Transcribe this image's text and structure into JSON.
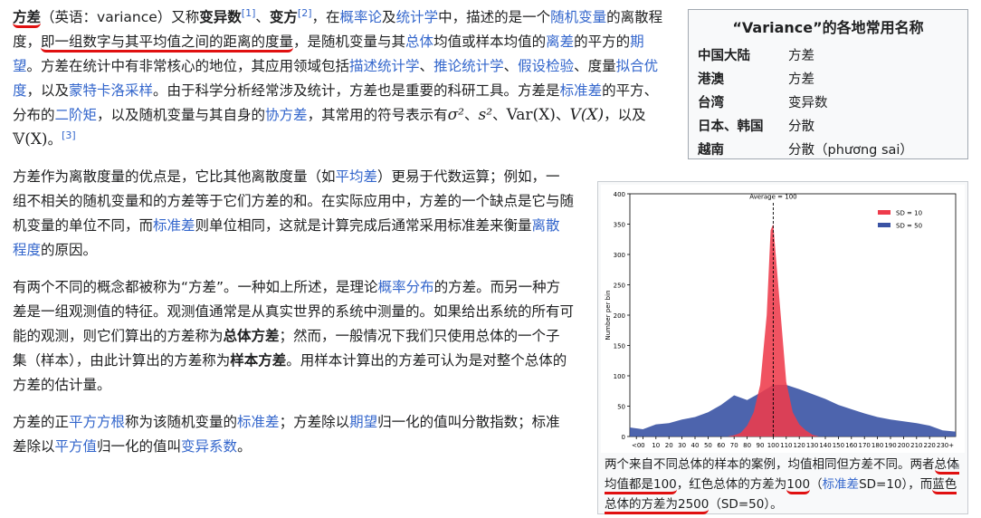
{
  "para1": {
    "term": "方差",
    "paren_open": "（英语：",
    "en": "variance",
    "paren_close": "）又称",
    "alt1": "变异数",
    "ref1": "[1]",
    "sep1": "、",
    "alt2": "变方",
    "ref2": "[2]",
    "t1": "，在",
    "link_prob": "概率论",
    "t2": "及",
    "link_stat": "统计学",
    "t3": "中，描述的是一个",
    "link_rv": "随机变量",
    "t4": "的离散程度，",
    "def": "即一组数字与其平均值之间的距离的度量",
    "t5": "，是随机变量与其",
    "link_pop": "总体",
    "t6": "均值或样本均值的",
    "link_dev": "离差",
    "t7": "的平方的",
    "link_exp": "期望",
    "t8": "。方差在统计中有非常核心的地位，其应用领域包括",
    "link_desc": "描述统计学",
    "t9": "、",
    "link_inf": "推论统计学",
    "t10": "、",
    "link_hyp": "假设检验",
    "t11": "、度量",
    "link_fit": "拟合优度",
    "t12": "，以及",
    "link_mc": "蒙特卡洛采样",
    "t13": "。由于科学分析经常涉及统计，方差也是重要的科研工具。方差是",
    "link_sd": "标准差",
    "t14": "的平方、分布的",
    "link_moment": "二阶矩",
    "t15": "，以及随机变量与其自身的",
    "link_cov": "协方差",
    "t16": "，其常用的符号表示有",
    "sym1": "σ²",
    "t17": "、",
    "sym2": "s²",
    "t18": "、",
    "sym3": "Var(X)",
    "t19": "、",
    "sym4": "V(X)",
    "t20": "，以及",
    "sym5": "𝕍(X)",
    "t21": "。",
    "ref3": "[3]"
  },
  "para2": {
    "t1": "方差作为离散度量的优点是，它比其他离散度量（如",
    "link_md": "平均差",
    "t2": "）更易于代数运算；例如，一组不相关的随机变量和的方差等于它们方差的和。在实际应用中，方差的一个缺点是它与随机变量的单位不同，而",
    "link_sd": "标准差",
    "t3": "则单位相同，这就是计算完成后通常采用标准差来衡量",
    "link_disp": "离散程度",
    "t4": "的原因。"
  },
  "para3": {
    "t1": "有两个不同的概念都被称为“方差”。一种如上所述，是理论",
    "link_pd": "概率分布",
    "t2": "的方差。而另一种方差是一组观测值的特征。观测值通常是从真实世界的系统中测量的。如果给出系统的所有可能的观测，则它们算出的方差称为",
    "b1": "总体方差",
    "t3": "；然而，一般情况下我们只使用总体的一个子集（样本），由此计算出的方差称为",
    "b2": "样本方差",
    "t4": "。用样本计算出的方差可认为是对整个总体的方差的估计量。"
  },
  "para4": {
    "t1": "方差的正",
    "link_sqrt": "平方方根",
    "t2": "称为该随机变量的",
    "link_sd": "标准差",
    "t3": "；方差除以",
    "link_exp": "期望",
    "t4": "归一化的值叫分散指数；标准差除以",
    "link_mean": "平方值",
    "t5": "归一化的值叫",
    "link_cv": "变异系数",
    "t6": "。"
  },
  "infobox": {
    "title": "“Variance”的各地常用名称",
    "rows": [
      {
        "region": "中国大陆",
        "name": "方差"
      },
      {
        "region": "港澳",
        "name": "方差"
      },
      {
        "region": "台湾",
        "name": "变异数"
      },
      {
        "region": "日本、韩国",
        "name": "分散"
      },
      {
        "region": "越南",
        "name": "分散（phương sai）"
      }
    ]
  },
  "figure": {
    "enlarge_icon": "enlarge-icon",
    "caption": {
      "t1": "两个来自不同总体的样本的案例，均值相同但方差不同。两者",
      "u1": "总体均值都是100",
      "t2": "，红色总体的方差为",
      "u2": "100",
      "t3": "（",
      "link_sd": "标准差",
      "t4": "SD=10），而",
      "u3": "蓝色总体的方差为2500",
      "t5": "（SD=50）。"
    }
  },
  "chart_data": {
    "type": "area",
    "title": "",
    "annotation": "Average = 100",
    "xlabel": "",
    "ylabel": "Number per bin",
    "categories": [
      "<0",
      "0",
      "10",
      "20",
      "30",
      "40",
      "50",
      "60",
      "70",
      "80",
      "90",
      "100",
      "110",
      "120",
      "130",
      "140",
      "150",
      "160",
      "170",
      "180",
      "190",
      "200",
      "210",
      "220",
      "230+"
    ],
    "ylim": [
      0,
      400
    ],
    "yticks": [
      0,
      50,
      100,
      150,
      200,
      250,
      300,
      350,
      400
    ],
    "legend_position": "top-right",
    "series": [
      {
        "name": "SD = 10",
        "color": "#ee3b4b",
        "x": [
          65,
          70,
          75,
          80,
          85,
          90,
          95,
          98,
          100,
          105,
          110,
          115,
          120,
          125,
          130,
          135
        ],
        "values": [
          0,
          2,
          6,
          18,
          40,
          85,
          200,
          340,
          350,
          220,
          90,
          40,
          20,
          10,
          3,
          0
        ]
      },
      {
        "name": "SD = 50",
        "color": "#3a53a4",
        "x": [
          -10,
          0,
          10,
          20,
          30,
          40,
          50,
          60,
          70,
          80,
          90,
          100,
          110,
          120,
          130,
          140,
          150,
          160,
          170,
          180,
          190,
          200,
          210,
          220,
          230,
          240
        ],
        "values": [
          15,
          12,
          20,
          22,
          28,
          32,
          40,
          52,
          68,
          60,
          72,
          85,
          85,
          78,
          70,
          62,
          52,
          45,
          38,
          32,
          28,
          25,
          22,
          18,
          10,
          8
        ]
      }
    ],
    "vline_x": 100
  }
}
